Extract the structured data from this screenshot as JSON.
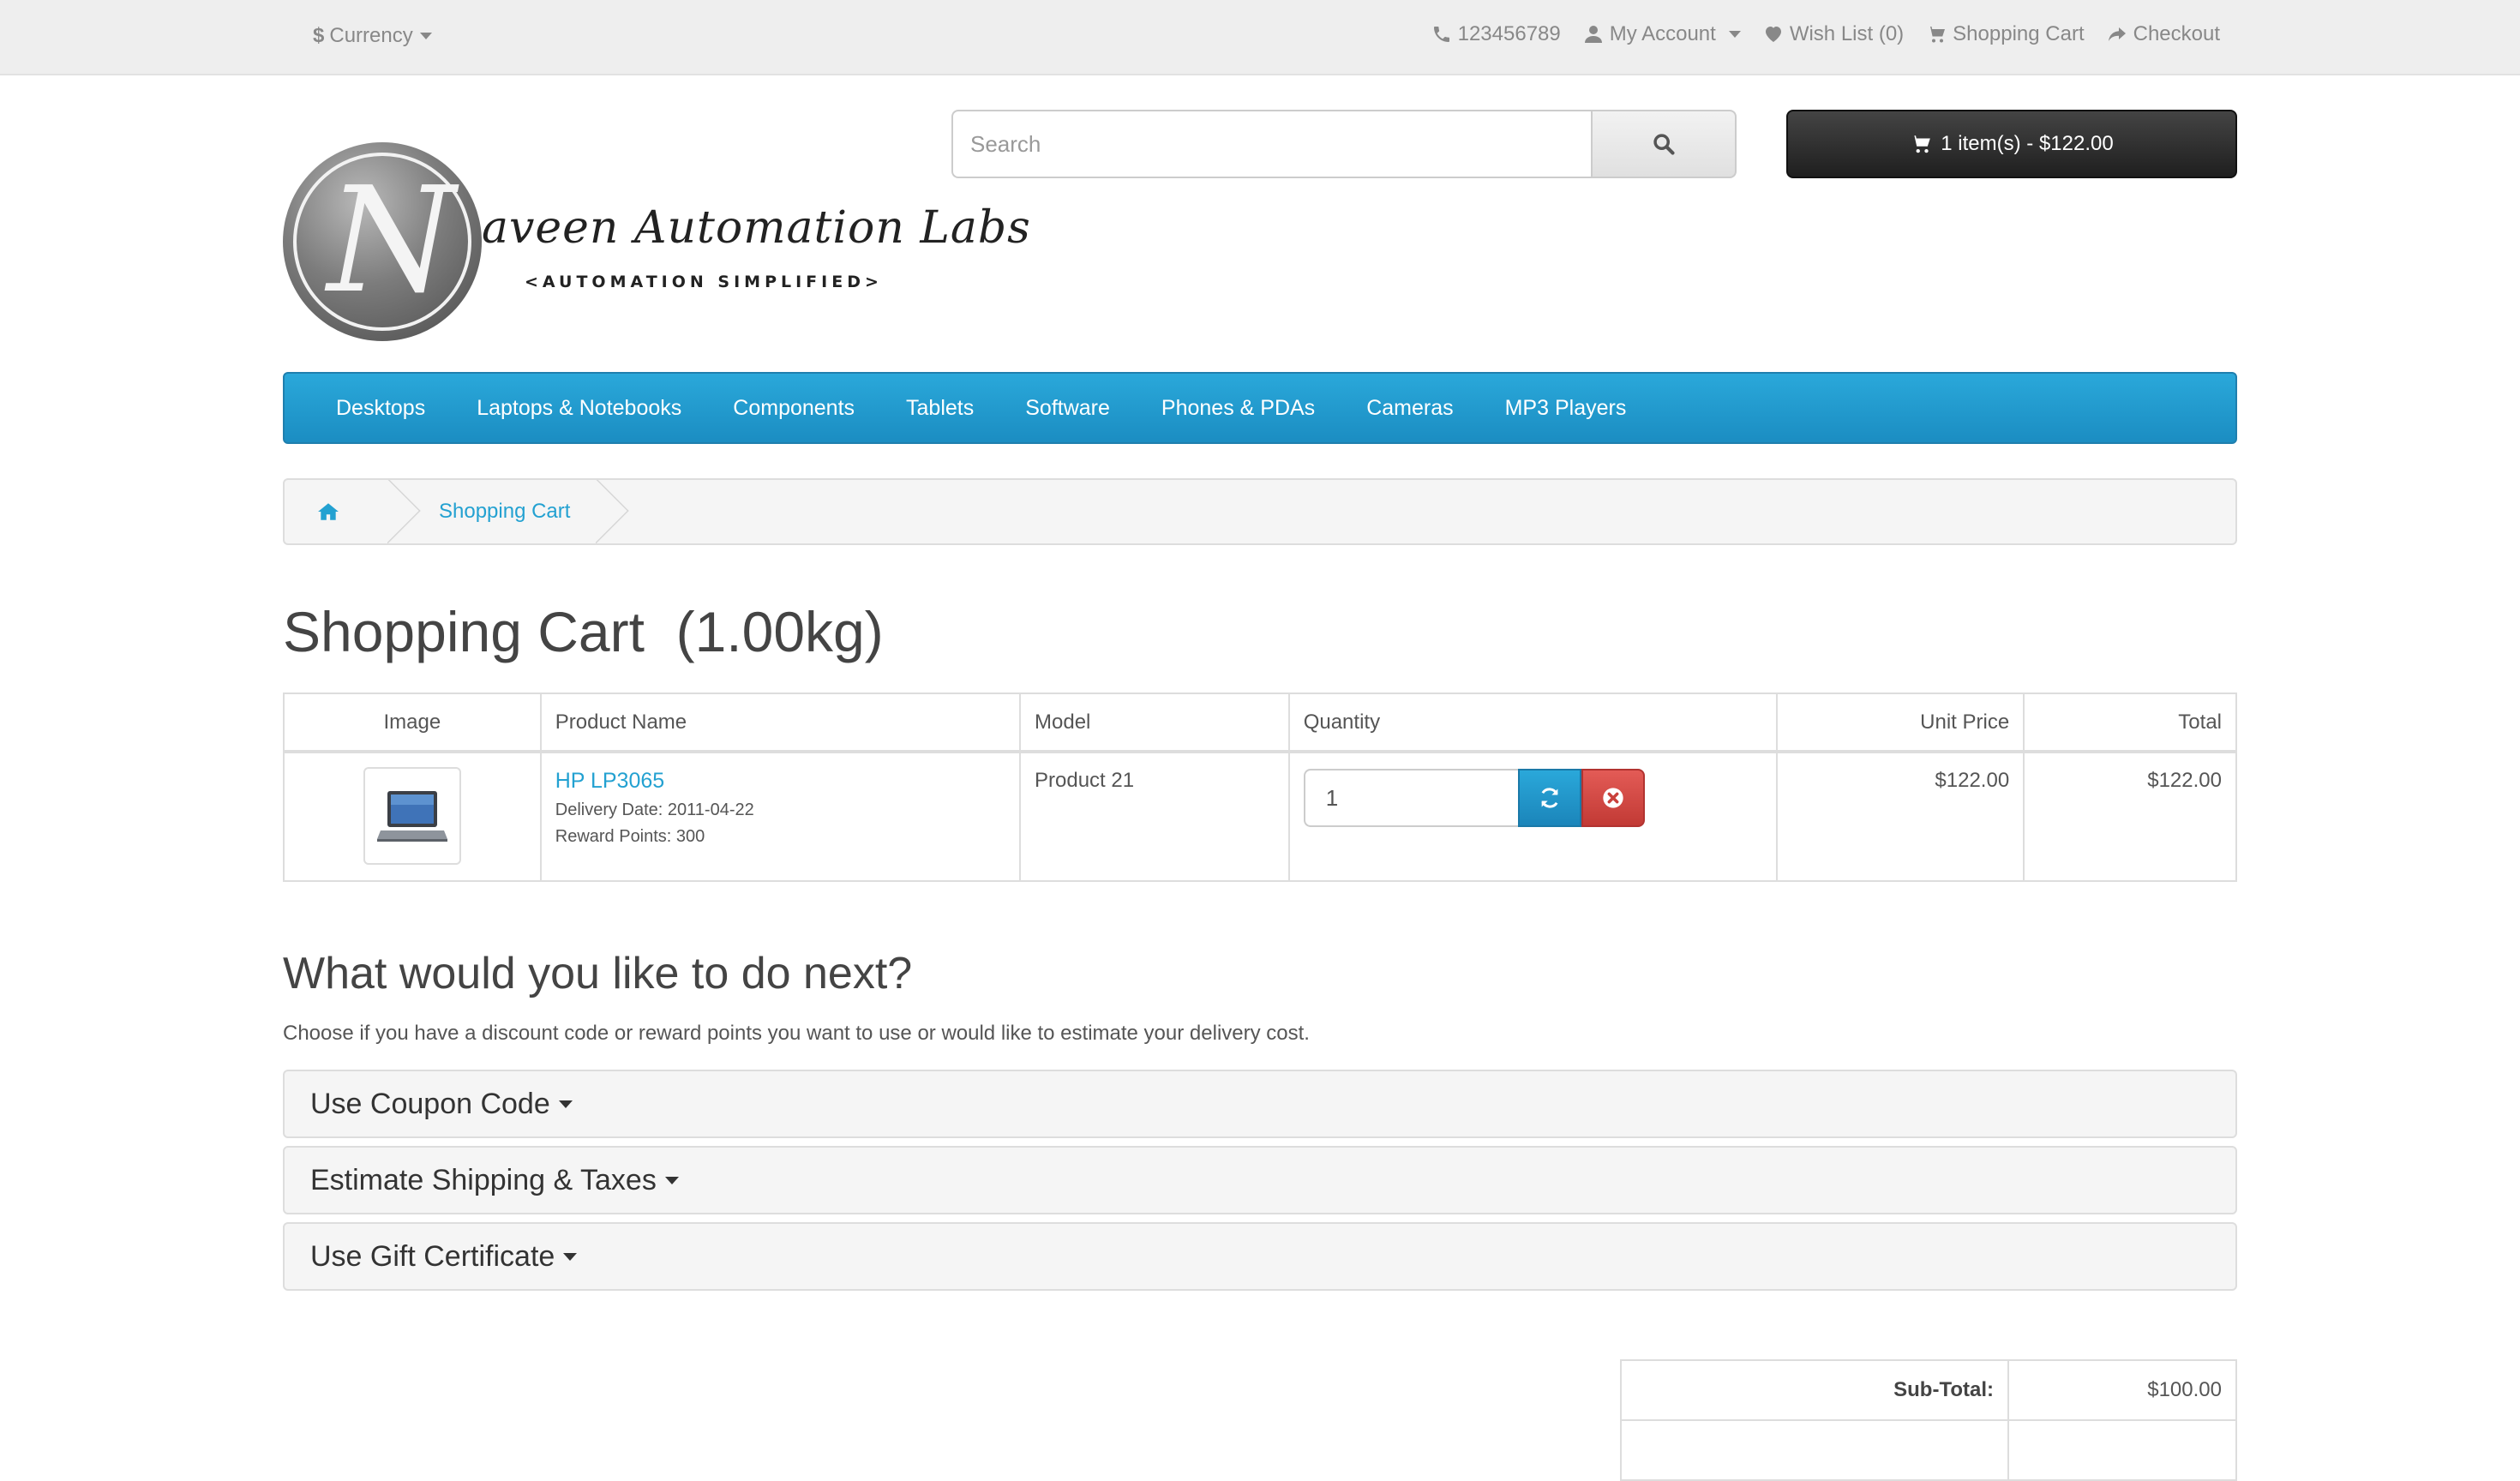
{
  "topbar": {
    "currency_symbol": "$",
    "currency_label": "Currency",
    "phone": "123456789",
    "my_account": "My Account",
    "wishlist": "Wish List (0)",
    "shopping_cart": "Shopping Cart",
    "checkout": "Checkout"
  },
  "logo": {
    "letter": "N",
    "script": "aveen Automation Labs",
    "tagline": "<AUTOMATION SIMPLIFIED>"
  },
  "search": {
    "placeholder": "Search"
  },
  "cart_button": {
    "label": "1 item(s) - $122.00"
  },
  "menu": {
    "items": [
      "Desktops",
      "Laptops & Notebooks",
      "Components",
      "Tablets",
      "Software",
      "Phones & PDAs",
      "Cameras",
      "MP3 Players"
    ]
  },
  "breadcrumb": {
    "current": "Shopping Cart"
  },
  "page": {
    "title": "Shopping Cart  (1.00kg)"
  },
  "cart_table": {
    "headers": [
      "Image",
      "Product Name",
      "Model",
      "Quantity",
      "Unit Price",
      "Total"
    ],
    "rows": [
      {
        "product_name": "HP LP3065",
        "delivery_date": "Delivery Date: 2011-04-22",
        "reward_points": "Reward Points: 300",
        "model": "Product 21",
        "quantity": "1",
        "unit_price": "$122.00",
        "total": "$122.00"
      }
    ]
  },
  "next": {
    "title": "What would you like to do next?",
    "description": "Choose if you have a discount code or reward points you want to use or would like to estimate your delivery cost.",
    "panels": [
      "Use Coupon Code",
      "Estimate Shipping & Taxes",
      "Use Gift Certificate"
    ]
  },
  "totals": {
    "subtotal_label": "Sub-Total:",
    "subtotal_value": "$100.00"
  },
  "colors": {
    "accent": "#23a1d1",
    "menu_bg": "#229ac8",
    "danger": "#da4f49",
    "dark_button": "#363636"
  }
}
